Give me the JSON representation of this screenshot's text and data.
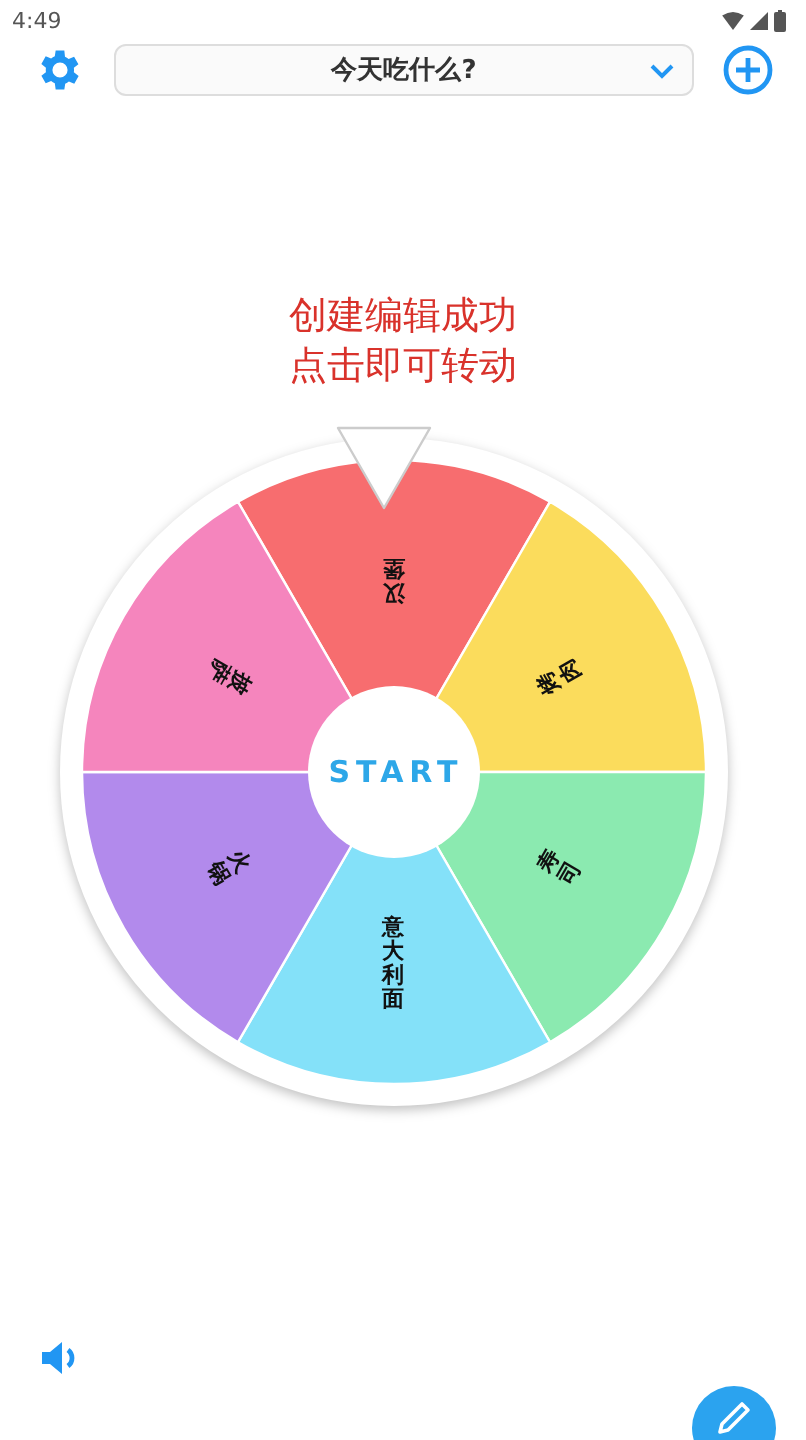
{
  "status_bar": {
    "time": "4:49"
  },
  "toolbar": {
    "title": "今天吃什么?"
  },
  "message": {
    "lines": [
      "创建编辑成功",
      "点击即可转动"
    ]
  },
  "wheel": {
    "start_label": "START",
    "segments": [
      {
        "label": "汉堡",
        "color": "#f76d6f"
      },
      {
        "label": "烤肉",
        "color": "#fbdc5c"
      },
      {
        "label": "寿司",
        "color": "#8beab0"
      },
      {
        "label": "意大利面",
        "color": "#84e1f9"
      },
      {
        "label": "火锅",
        "color": "#b28aec"
      },
      {
        "label": "披萨",
        "color": "#f585bd"
      }
    ]
  }
}
